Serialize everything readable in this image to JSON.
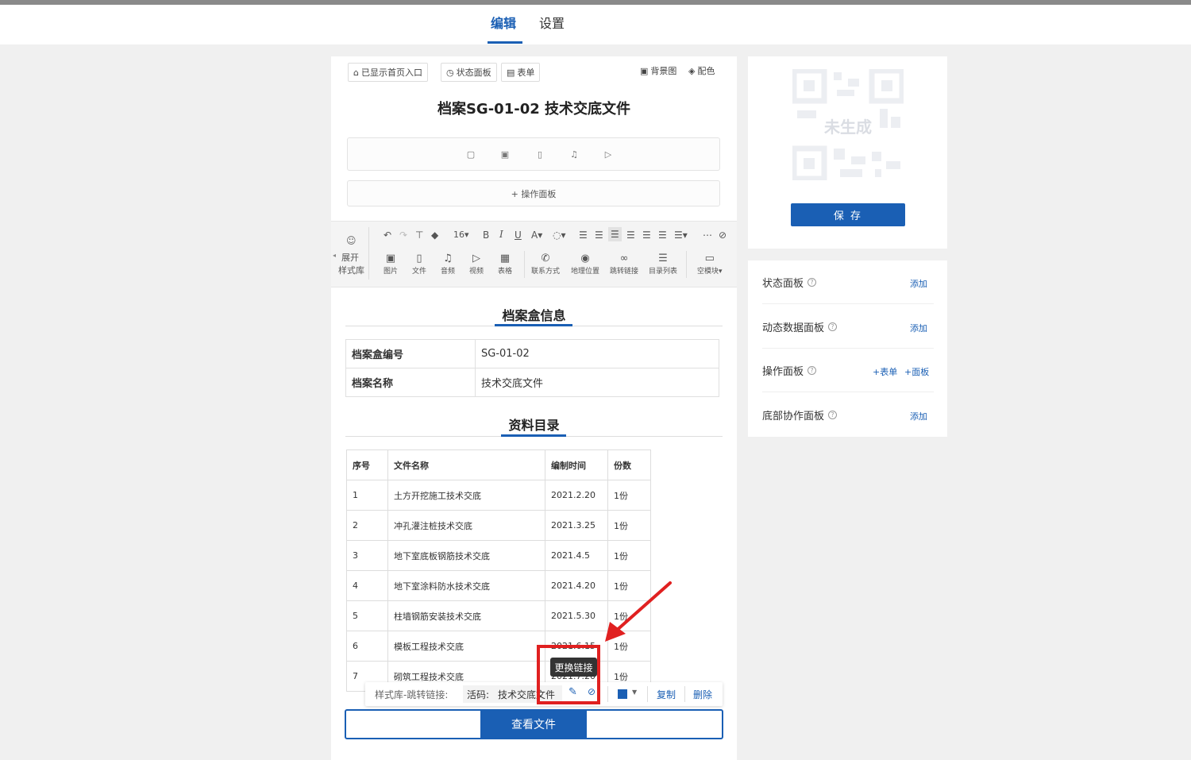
{
  "header": {
    "tabs": [
      {
        "label": "编辑"
      },
      {
        "label": "设置"
      }
    ]
  },
  "editor": {
    "chips": {
      "home_entry": "已显示首页入口",
      "status_panel": "状态面板",
      "form": "表单"
    },
    "top_links": {
      "background": "背景图",
      "color": "配色"
    },
    "title": "档案SG-01-02 技术交底文件",
    "op_panel": "+ 操作面板"
  },
  "toolbar": {
    "expand_label_1": "展开",
    "expand_label_2": "样式库",
    "font_size": "16",
    "items": [
      {
        "label": "图片"
      },
      {
        "label": "文件"
      },
      {
        "label": "音频"
      },
      {
        "label": "视频"
      },
      {
        "label": "表格"
      },
      {
        "label": "联系方式"
      },
      {
        "label": "地理位置"
      },
      {
        "label": "跳转链接"
      },
      {
        "label": "目录列表"
      },
      {
        "label": "空模块"
      }
    ]
  },
  "box_info": {
    "heading": "档案盒信息",
    "rows": [
      {
        "key": "档案盒编号",
        "value": "SG-01-02"
      },
      {
        "key": "档案名称",
        "value": "技术交底文件"
      }
    ]
  },
  "directory": {
    "heading": "资料目录",
    "columns": [
      "序号",
      "文件名称",
      "编制时间",
      "份数"
    ],
    "rows": [
      [
        "1",
        "土方开挖施工技术交底",
        "2021.2.20",
        "1份"
      ],
      [
        "2",
        "冲孔灌注桩技术交底",
        "2021.3.25",
        "1份"
      ],
      [
        "3",
        "地下室底板钢筋技术交底",
        "2021.4.5",
        "1份"
      ],
      [
        "4",
        "地下室涂料防水技术交底",
        "2021.4.20",
        "1份"
      ],
      [
        "5",
        "柱墙钢筋安装技术交底",
        "2021.5.30",
        "1份"
      ],
      [
        "6",
        "模板工程技术交底",
        "2021.6.15",
        "1份"
      ],
      [
        "7",
        "砌筑工程技术交底",
        "2021.7.20",
        "1份"
      ]
    ]
  },
  "float_bar": {
    "label": "样式库-跳转链接:",
    "code_prefix": "活码:",
    "code_name": "技术交底文件",
    "copy": "复制",
    "delete": "删除"
  },
  "tooltip": "更换链接",
  "view_button": "查看文件",
  "qr": {
    "placeholder": "未生成",
    "save": "保 存"
  },
  "panels": [
    {
      "label": "状态面板",
      "actions": [
        "添加"
      ]
    },
    {
      "label": "动态数据面板",
      "actions": [
        "添加"
      ]
    },
    {
      "label": "操作面板",
      "actions": [
        "+表单",
        "+面板"
      ]
    },
    {
      "label": "底部协作面板",
      "actions": [
        "添加"
      ]
    }
  ],
  "colors": {
    "accent": "#1a5fb4",
    "highlight": "#e02020"
  }
}
